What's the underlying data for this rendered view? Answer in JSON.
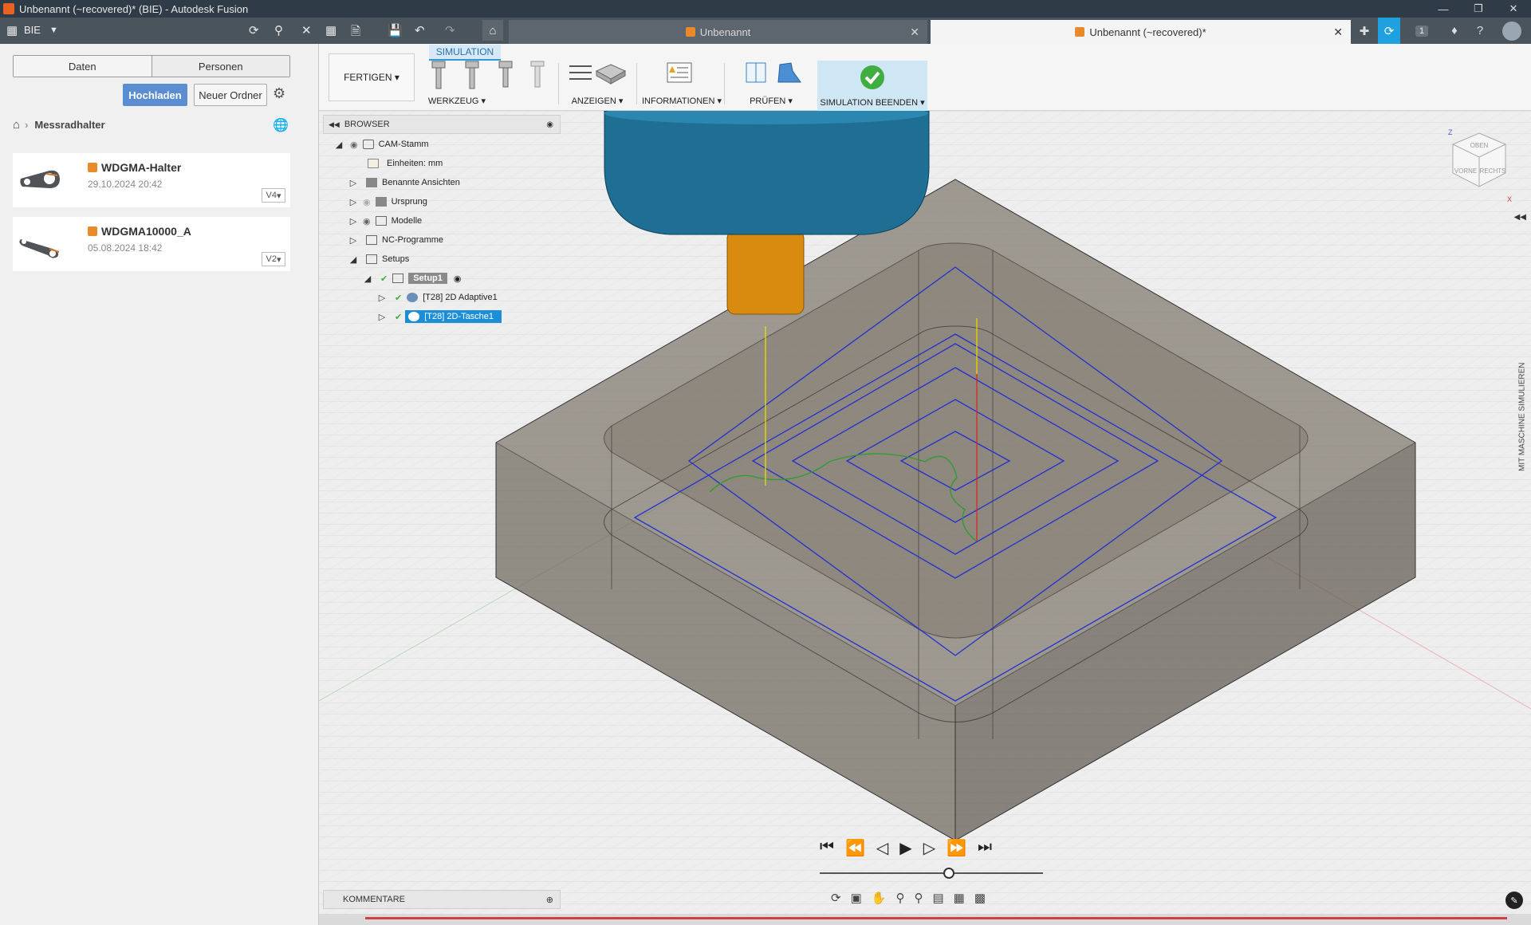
{
  "window": {
    "title": "Unbenannt (~recovered)* (BIE) - Autodesk Fusion"
  },
  "topbar": {
    "team": "BIE"
  },
  "tabs": [
    {
      "label": "Unbenannt",
      "active": false
    },
    {
      "label": "Unbenannt (~recovered)*",
      "active": true
    }
  ],
  "notifications": {
    "count": "1"
  },
  "datapanel": {
    "tab_data": "Daten",
    "tab_people": "Personen",
    "upload": "Hochladen",
    "new_folder": "Neuer Ordner",
    "breadcrumb": "Messradhalter",
    "files": [
      {
        "name": "WDGMA-Halter",
        "date": "29.10.2024 20:42",
        "version": "V4"
      },
      {
        "name": "WDGMA10000_A",
        "date": "05.08.2024 18:42",
        "version": "V2"
      }
    ]
  },
  "toolbar": {
    "workspace": "FERTIGEN",
    "active_tab": "SIMULATION",
    "groups": {
      "tool": "WERKZEUG",
      "show": "ANZEIGEN",
      "info": "INFORMATIONEN",
      "check": "PRÜFEN",
      "end": "SIMULATION BEENDEN"
    }
  },
  "browser": {
    "title": "BROWSER",
    "items": {
      "root": "CAM-Stamm",
      "units": "Einheiten: mm",
      "views": "Benannte Ansichten",
      "origin": "Ursprung",
      "models": "Modelle",
      "nc": "NC-Programme",
      "setups": "Setups",
      "setup1": "Setup1",
      "op1": "[T28] 2D Adaptive1",
      "op2": "[T28] 2D-Tasche1"
    }
  },
  "viewcube": {
    "top": "OBEN",
    "front": "VORNE",
    "right": "RECHTS",
    "axis_z": "Z",
    "axis_x": "X"
  },
  "side_panel": "MIT MASCHINE SIMULIEREN",
  "comments": {
    "title": "KOMMENTARE"
  },
  "playback": {
    "progress": 0.58
  },
  "colors": {
    "accent": "#2a9ad8",
    "upload": "#5a8ed0",
    "stock": "#8a8074",
    "tool_holder": "#1f6f94",
    "tool_shank": "#d98b10",
    "toolpath": "#2230d0",
    "path_green": "#2a9d2a",
    "path_red": "#e02020",
    "path_yellow": "#e5e000"
  }
}
